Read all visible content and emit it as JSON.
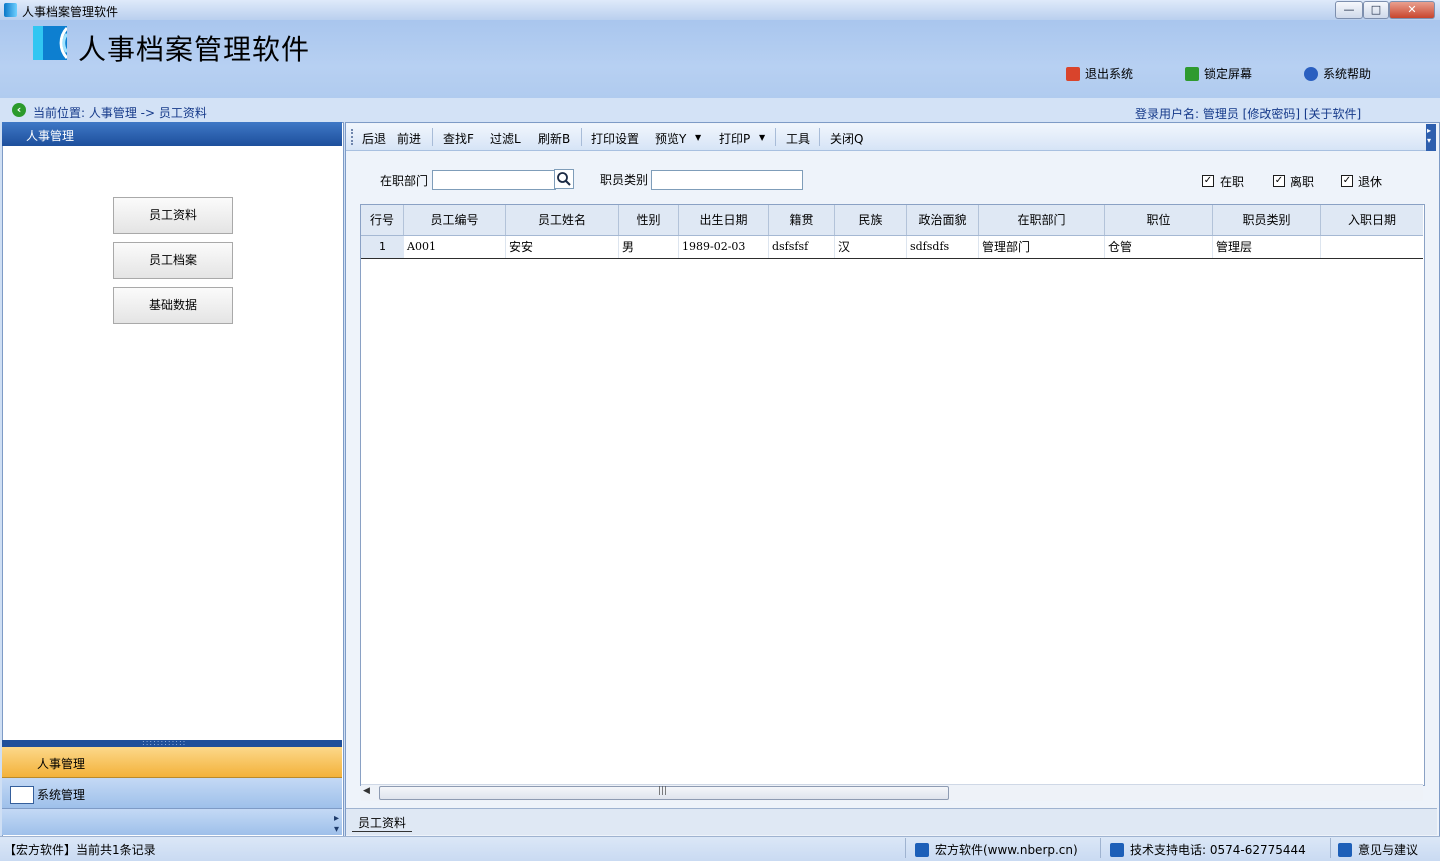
{
  "window": {
    "title": "人事档案管理软件",
    "btn_min": "—",
    "btn_max": "□",
    "btn_close": "✕"
  },
  "header": {
    "app_title": "人事档案管理软件",
    "actions": [
      {
        "label": "退出系统",
        "icon": "exit-icon",
        "color": "#d9442c"
      },
      {
        "label": "锁定屏幕",
        "icon": "lock-screen-icon",
        "color": "#2f9a2f"
      },
      {
        "label": "系统帮助",
        "icon": "help-icon",
        "color": "#2a5fc0"
      }
    ]
  },
  "breadcrumb": {
    "text": "当前位置: 人事管理 -> 员工资料"
  },
  "user": {
    "text": "登录用户名: 管理员  [修改密码]  [关于软件]"
  },
  "sidebar": {
    "header": "人事管理",
    "buttons": [
      "员工资料",
      "员工档案",
      "基础数据"
    ],
    "groups": [
      "人事管理",
      "系统管理"
    ]
  },
  "toolbar": {
    "items": [
      "后退",
      "前进",
      "查找F",
      "过滤L",
      "刷新B",
      "打印设置",
      "预览Y",
      "打印P",
      "工具",
      "关闭Q"
    ]
  },
  "filters": {
    "dept_label": "在职部门",
    "dept_value": "",
    "category_label": "职员类别",
    "category_value": "",
    "checks": [
      {
        "label": "在职",
        "checked": true
      },
      {
        "label": "离职",
        "checked": true
      },
      {
        "label": "退休",
        "checked": true
      }
    ]
  },
  "grid": {
    "columns": [
      "行号",
      "员工编号",
      "员工姓名",
      "性别",
      "出生日期",
      "籍贯",
      "民族",
      "政治面貌",
      "在职部门",
      "职位",
      "职员类别",
      "入职日期"
    ],
    "rows": [
      [
        "1",
        "A001",
        "安安",
        "男",
        "1989-02-03",
        "dsfsfsf",
        "汉",
        "sdfsdfs",
        "管理部门",
        "仓管",
        "管理层",
        ""
      ]
    ]
  },
  "tabs": [
    "员工资料"
  ],
  "status": {
    "left": "【宏方软件】当前共1条记录",
    "company": "宏方软件(www.nberp.cn)",
    "phone": "技术支持电话: 0574-62775444",
    "feedback": "意见与建议"
  }
}
